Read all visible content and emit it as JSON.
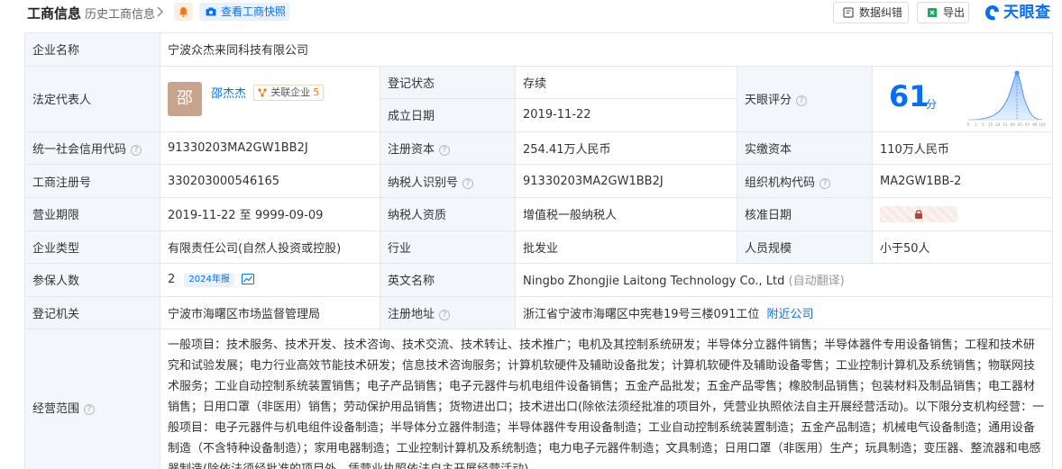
{
  "header": {
    "title": "工商信息",
    "history_link": "历史工商信息",
    "snapshot_button": "查看工商快照",
    "data_error_button": "数据纠错",
    "export_button": "导出",
    "logo_text": "天眼查"
  },
  "fields": {
    "company_name_label": "企业名称",
    "company_name": "宁波众杰来同科技有限公司",
    "legal_rep_label": "法定代表人",
    "legal_rep_avatar": "邵",
    "legal_rep_name": "邵杰杰",
    "related_label": "关联企业",
    "related_count": "5",
    "reg_status_label": "登记状态",
    "reg_status": "存续",
    "established_label": "成立日期",
    "established": "2019-11-22",
    "score_label": "天眼评分",
    "score": "61",
    "score_unit": "分",
    "credit_code_label": "统一社会信用代码",
    "credit_code": "91330203MA2GW1BB2J",
    "reg_capital_label": "注册资本",
    "reg_capital": "254.41万人民币",
    "paid_capital_label": "实缴资本",
    "paid_capital": "110万人民币",
    "reg_no_label": "工商注册号",
    "reg_no": "330203000546165",
    "tax_id_label": "纳税人识别号",
    "tax_id": "91330203MA2GW1BB2J",
    "org_code_label": "组织机构代码",
    "org_code": "MA2GW1BB-2",
    "term_label": "营业期限",
    "term": "2019-11-22 至 9999-09-09",
    "tax_quality_label": "纳税人资质",
    "tax_quality": "增值税一般纳税人",
    "approval_date_label": "核准日期",
    "type_label": "企业类型",
    "type": "有限责任公司(自然人投资或控股)",
    "industry_label": "行业",
    "industry": "批发业",
    "staff_label": "人员规模",
    "staff": "小于50人",
    "insured_label": "参保人数",
    "insured": "2",
    "insured_badge": "2024年报",
    "english_label": "英文名称",
    "english_name": "Ningbo Zhongjie Laitong Technology Co., Ltd",
    "english_note": "(自动翻译)",
    "authority_label": "登记机关",
    "authority": "宁波市海曙区市场监督管理局",
    "address_label": "注册地址",
    "address": "浙江省宁波市海曙区中宪巷19号三楼091工位",
    "nearby_link": "附近公司",
    "scope_label": "经营范围",
    "scope": "一般项目：技术服务、技术开发、技术咨询、技术交流、技术转让、技术推广；电机及其控制系统研发；半导体分立器件销售；半导体器件专用设备销售；工程和技术研究和试验发展；电力行业高效节能技术研发；信息技术咨询服务；计算机软硬件及辅助设备批发；计算机软硬件及辅助设备零售；工业控制计算机及系统销售；物联网技术服务；工业自动控制系统装置销售；电子产品销售；电子元器件与机电组件设备销售；五金产品批发；五金产品零售；橡胶制品销售；包装材料及制品销售；电工器材销售；日用口罩（非医用）销售；劳动保护用品销售；货物进出口；技术进出口(除依法须经批准的项目外，凭营业执照依法自主开展经营活动)。以下限分支机构经营：一般项目：电子元器件与机电组件设备制造；半导体分立器件制造；半导体器件专用设备制造；工业自动控制系统装置制造；五金产品制造；机械电气设备制造；通用设备制造（不含特种设备制造）；家用电器制造；工业控制计算机及系统制造；电力电子元器件制造；文具制造；日用口罩（非医用）生产；玩具制造；变压器、整流器和电感器制造(除依法须经批准的项目外，凭营业执照依法自主开展经营活动)。"
  },
  "score_chart_ticks": [
    "0",
    "1",
    "5",
    "15",
    "28",
    "51",
    "69",
    "85",
    "97",
    "99",
    "100"
  ],
  "colors": {
    "brand": "#0a6ef0",
    "status_green": "#1aab5f",
    "label_bg": "#f3f6fa",
    "border": "#e4e8ee"
  },
  "icons": {
    "bell": "bell-icon",
    "camera": "camera-icon",
    "help": "help-circle-icon",
    "lock": "lock-icon",
    "trend": "trend-chart-icon"
  }
}
